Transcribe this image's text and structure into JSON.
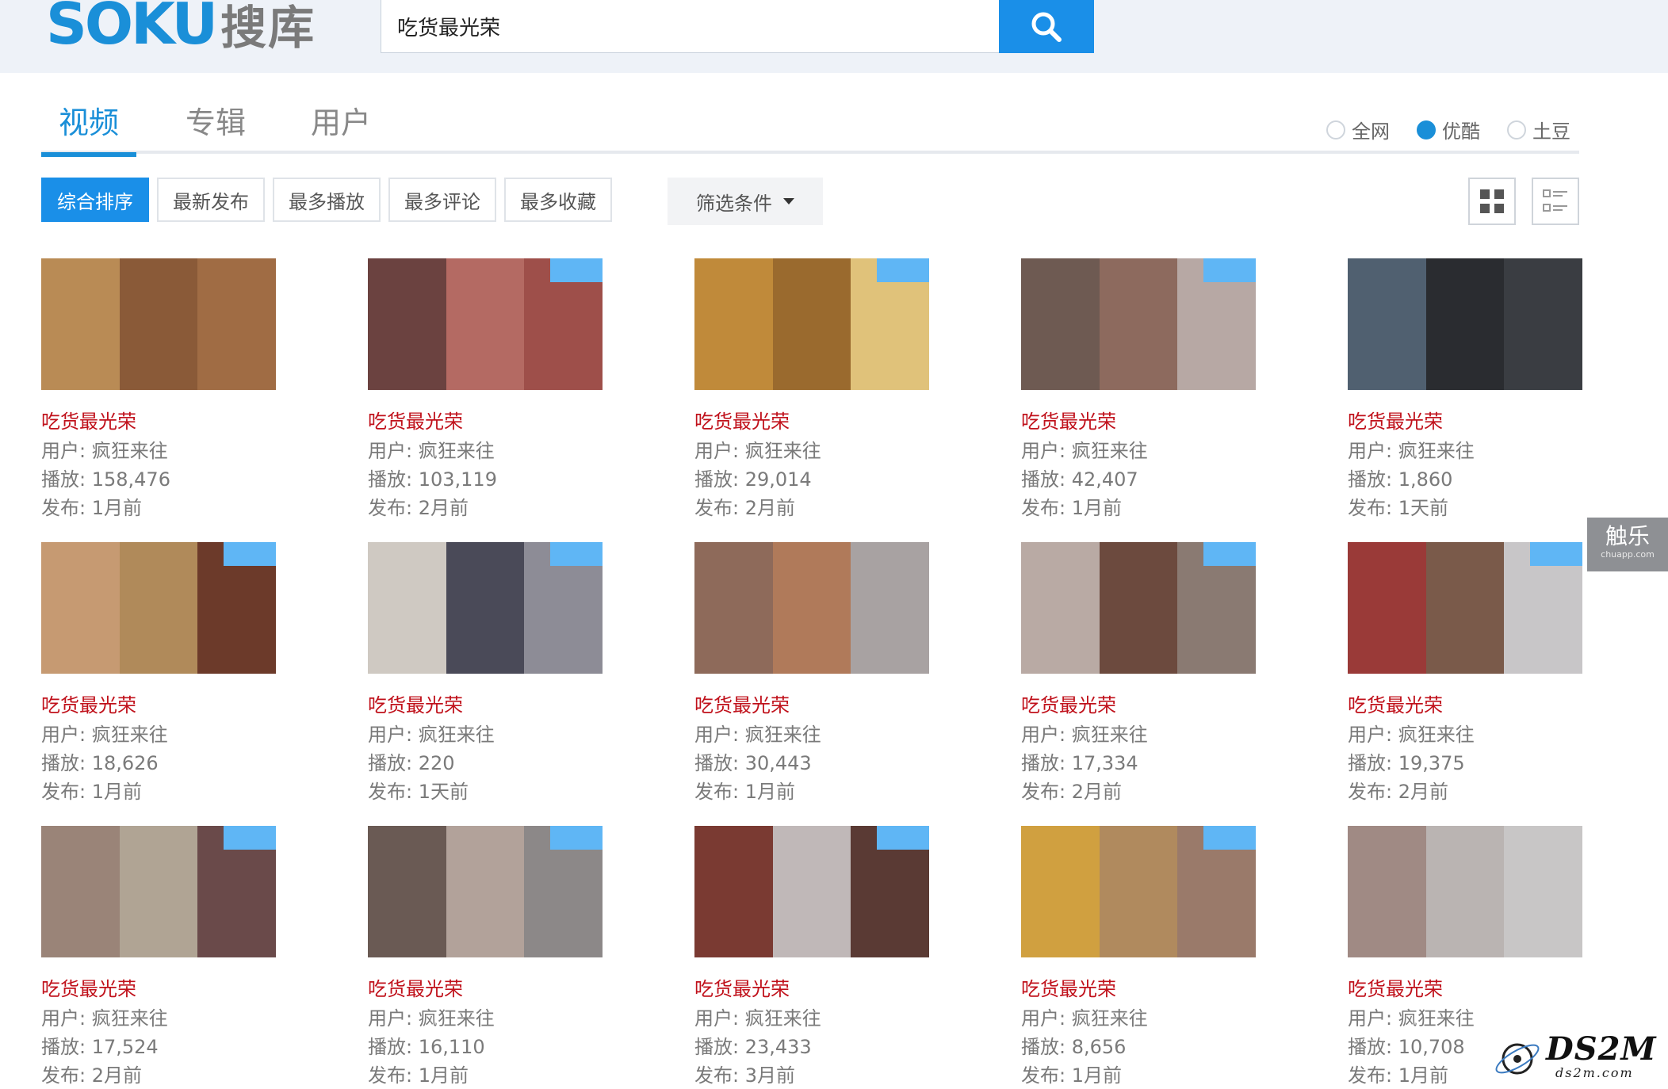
{
  "header": {
    "logo_en": "SOKU",
    "logo_cn": "搜库",
    "search_value": "吃货最光荣",
    "accent": "#1a8fd8"
  },
  "tabs": [
    {
      "label": "视频",
      "active": true
    },
    {
      "label": "专辑",
      "active": false
    },
    {
      "label": "用户",
      "active": false
    }
  ],
  "scope": [
    {
      "label": "全网",
      "selected": false
    },
    {
      "label": "优酷",
      "selected": true
    },
    {
      "label": "土豆",
      "selected": false
    }
  ],
  "sort": [
    "综合排序",
    "最新发布",
    "最多播放",
    "最多评论",
    "最多收藏"
  ],
  "sort_active": 0,
  "filter_label": "筛选条件",
  "videos": [
    {
      "title": "吃货最光荣",
      "user": "用户: 疯狂来往",
      "plays": "播放: 158,476",
      "published": "发布: 1月前",
      "colors": [
        "#b98b55",
        "#8a5a38",
        "#a06c44"
      ],
      "badge": false
    },
    {
      "title": "吃货最光荣",
      "user": "用户: 疯狂来往",
      "plays": "播放: 103,119",
      "published": "发布: 2月前",
      "colors": [
        "#6b4240",
        "#b46a63",
        "#9e4f4a"
      ],
      "badge": true
    },
    {
      "title": "吃货最光荣",
      "user": "用户: 疯狂来往",
      "plays": "播放: 29,014",
      "published": "发布: 2月前",
      "colors": [
        "#c08a3a",
        "#9a6a2e",
        "#e0c27a"
      ],
      "badge": true
    },
    {
      "title": "吃货最光荣",
      "user": "用户: 疯狂来往",
      "plays": "播放: 42,407",
      "published": "发布: 1月前",
      "colors": [
        "#6e5a52",
        "#8d6a5e",
        "#b7a8a4"
      ],
      "badge": true
    },
    {
      "title": "吃货最光荣",
      "user": "用户: 疯狂来往",
      "plays": "播放: 1,860",
      "published": "发布: 1天前",
      "colors": [
        "#506070",
        "#2a2c30",
        "#3a3d42"
      ],
      "badge": false
    },
    {
      "title": "吃货最光荣",
      "user": "用户: 疯狂来往",
      "plays": "播放: 18,626",
      "published": "发布: 1月前",
      "colors": [
        "#c69a72",
        "#b08a5a",
        "#6c3a2a"
      ],
      "badge": true
    },
    {
      "title": "吃货最光荣",
      "user": "用户: 疯狂来往",
      "plays": "播放: 220",
      "published": "发布: 1天前",
      "colors": [
        "#cfc9c2",
        "#4a4a58",
        "#8d8c96"
      ],
      "badge": true
    },
    {
      "title": "吃货最光荣",
      "user": "用户: 疯狂来往",
      "plays": "播放: 30,443",
      "published": "发布: 1月前",
      "colors": [
        "#8e6a5a",
        "#b07a5a",
        "#a8a2a2"
      ],
      "badge": false
    },
    {
      "title": "吃货最光荣",
      "user": "用户: 疯狂来往",
      "plays": "播放: 17,334",
      "published": "发布: 2月前",
      "colors": [
        "#b9aaa4",
        "#6c4a3e",
        "#8a7a72"
      ],
      "badge": true
    },
    {
      "title": "吃货最光荣",
      "user": "用户: 疯狂来往",
      "plays": "播放: 19,375",
      "published": "发布: 2月前",
      "colors": [
        "#9a3a38",
        "#7a5a4a",
        "#c8c6c8"
      ],
      "badge": true
    },
    {
      "title": "吃货最光荣",
      "user": "用户: 疯狂来往",
      "plays": "播放: 17,524",
      "published": "发布: 2月前",
      "colors": [
        "#9a8478",
        "#b0a494",
        "#6a4a4a"
      ],
      "badge": true
    },
    {
      "title": "吃货最光荣",
      "user": "用户: 疯狂来往",
      "plays": "播放: 16,110",
      "published": "发布: 1月前",
      "colors": [
        "#6a5a54",
        "#b2a29a",
        "#8c8888"
      ],
      "badge": true
    },
    {
      "title": "吃货最光荣",
      "user": "用户: 疯狂来往",
      "plays": "播放: 23,433",
      "published": "发布: 3月前",
      "colors": [
        "#7a3a32",
        "#c0b8b8",
        "#5a3a34"
      ],
      "badge": true
    },
    {
      "title": "吃货最光荣",
      "user": "用户: 疯狂来往",
      "plays": "播放: 8,656",
      "published": "发布: 1月前",
      "colors": [
        "#d0a040",
        "#b08a5e",
        "#9a7a6a"
      ],
      "badge": true
    },
    {
      "title": "吃货最光荣",
      "user": "用户: 疯狂来往",
      "plays": "播放: 10,708",
      "published": "发布: 1月前",
      "colors": [
        "#a08a84",
        "#bab4b2",
        "#c8c6c6"
      ],
      "badge": false
    }
  ],
  "watermark_chuapp": {
    "cn": "触乐",
    "en": "chuapp.com"
  },
  "watermark_ds2m": {
    "main": "DS2M",
    "sub": "ds2m.com"
  }
}
